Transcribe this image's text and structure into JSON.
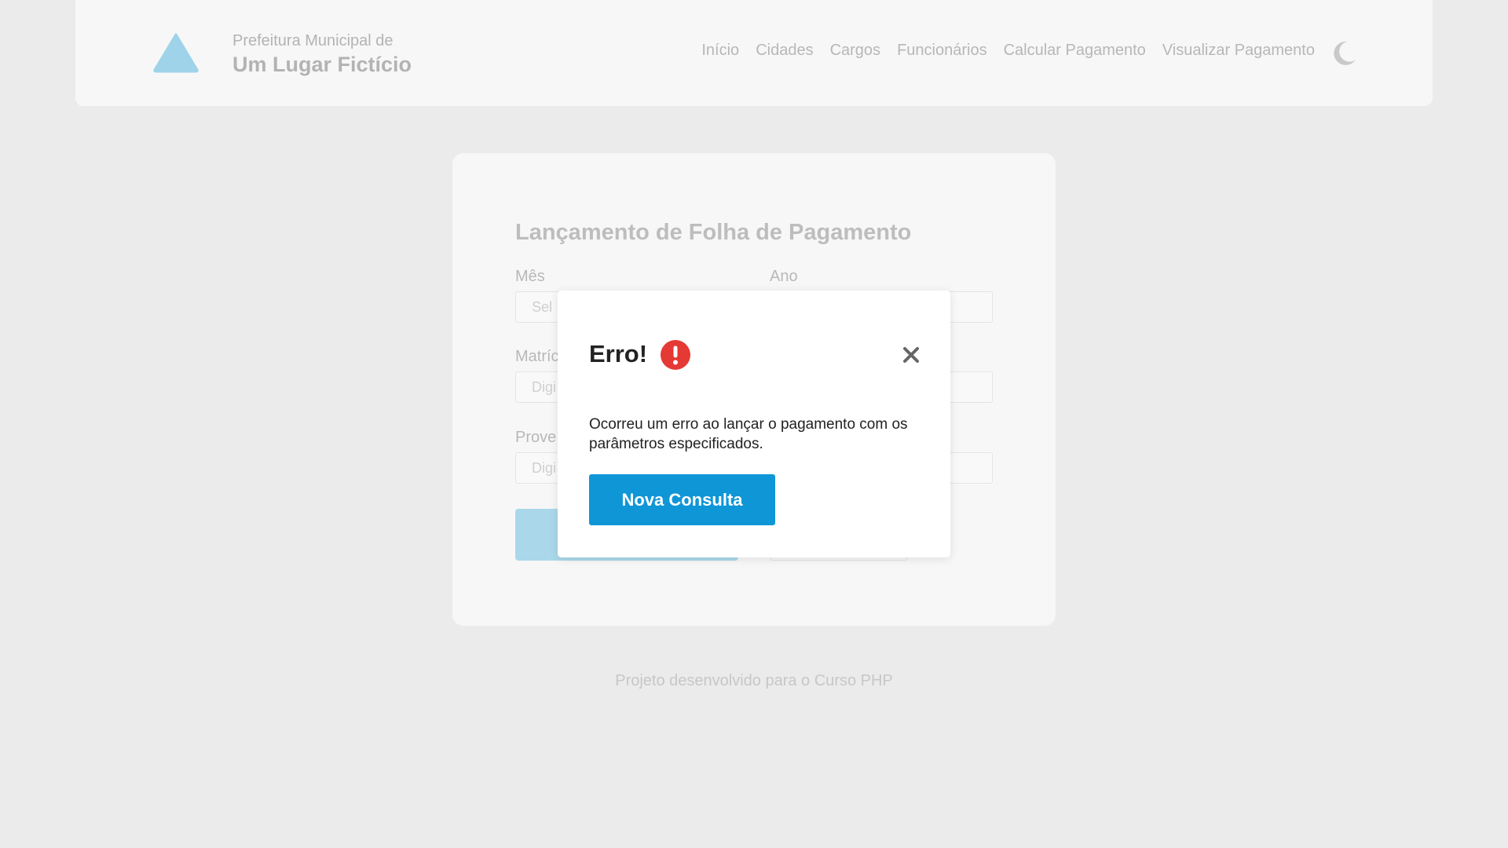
{
  "header": {
    "brand_sub": "Prefeitura Municipal de",
    "brand_main": "Um Lugar Fictício",
    "logo_icon": "triangle-logo",
    "theme_icon": "moon-icon",
    "nav": [
      {
        "label": "Início"
      },
      {
        "label": "Cidades"
      },
      {
        "label": "Cargos"
      },
      {
        "label": "Funcionários"
      },
      {
        "label": "Calcular Pagamento"
      },
      {
        "label": "Visualizar Pagamento"
      }
    ]
  },
  "form": {
    "title": "Lançamento de Folha de Pagamento",
    "fields": [
      {
        "label": "Mês",
        "placeholder": "Sel"
      },
      {
        "label": "Ano",
        "placeholder": ""
      },
      {
        "label": "Matríc",
        "placeholder": "Digi"
      },
      {
        "label": "",
        "placeholder": ""
      },
      {
        "label": "Prove",
        "placeholder": "Digi"
      },
      {
        "label": "",
        "placeholder": ""
      }
    ]
  },
  "footer": {
    "text": "Projeto desenvolvido para o Curso PHP"
  },
  "modal": {
    "title": "Erro!",
    "icon": "exclamation-icon",
    "close_icon": "close-icon",
    "message": "Ocorreu um erro ao lançar o pagamento com os parâmetros especificados.",
    "button_label": "Nova Consulta"
  },
  "colors": {
    "page_bg": "#ebebeb",
    "header_bg": "#f7f7f7",
    "accent": "#0f96d7",
    "accent_faded": "#aad8ea",
    "error": "#e53935",
    "logo": "#9ed3ea"
  }
}
